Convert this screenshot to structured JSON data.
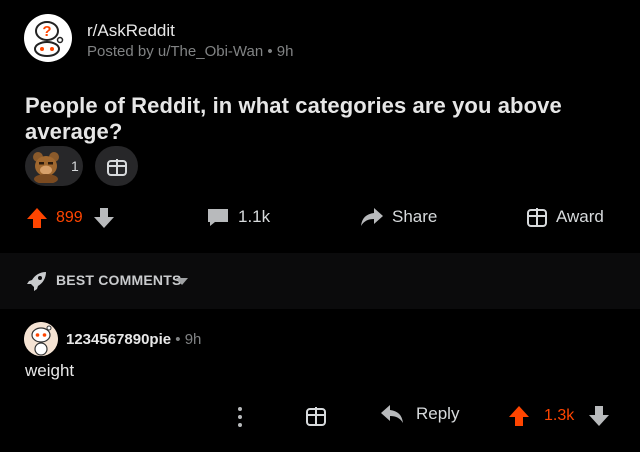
{
  "post": {
    "subreddit": "r/AskReddit",
    "author": "Posted by u/The_Obi-Wan",
    "age": "9h",
    "title": "People of Reddit, in what categories are you above average?",
    "awards": {
      "count": "1",
      "award_icon": "bear-award-icon",
      "gift_icon": "gift-icon"
    },
    "score": "899",
    "comments": "1.1k",
    "share_label": "Share",
    "award_label": "Award"
  },
  "sort": {
    "label": "BEST COMMENTS"
  },
  "comment": {
    "username": "1234567890pie",
    "age": "9h",
    "body": "weight",
    "reply_label": "Reply",
    "score": "1.3k"
  },
  "colors": {
    "accent": "#ff4500",
    "background": "#000000",
    "muted": "#818384"
  }
}
